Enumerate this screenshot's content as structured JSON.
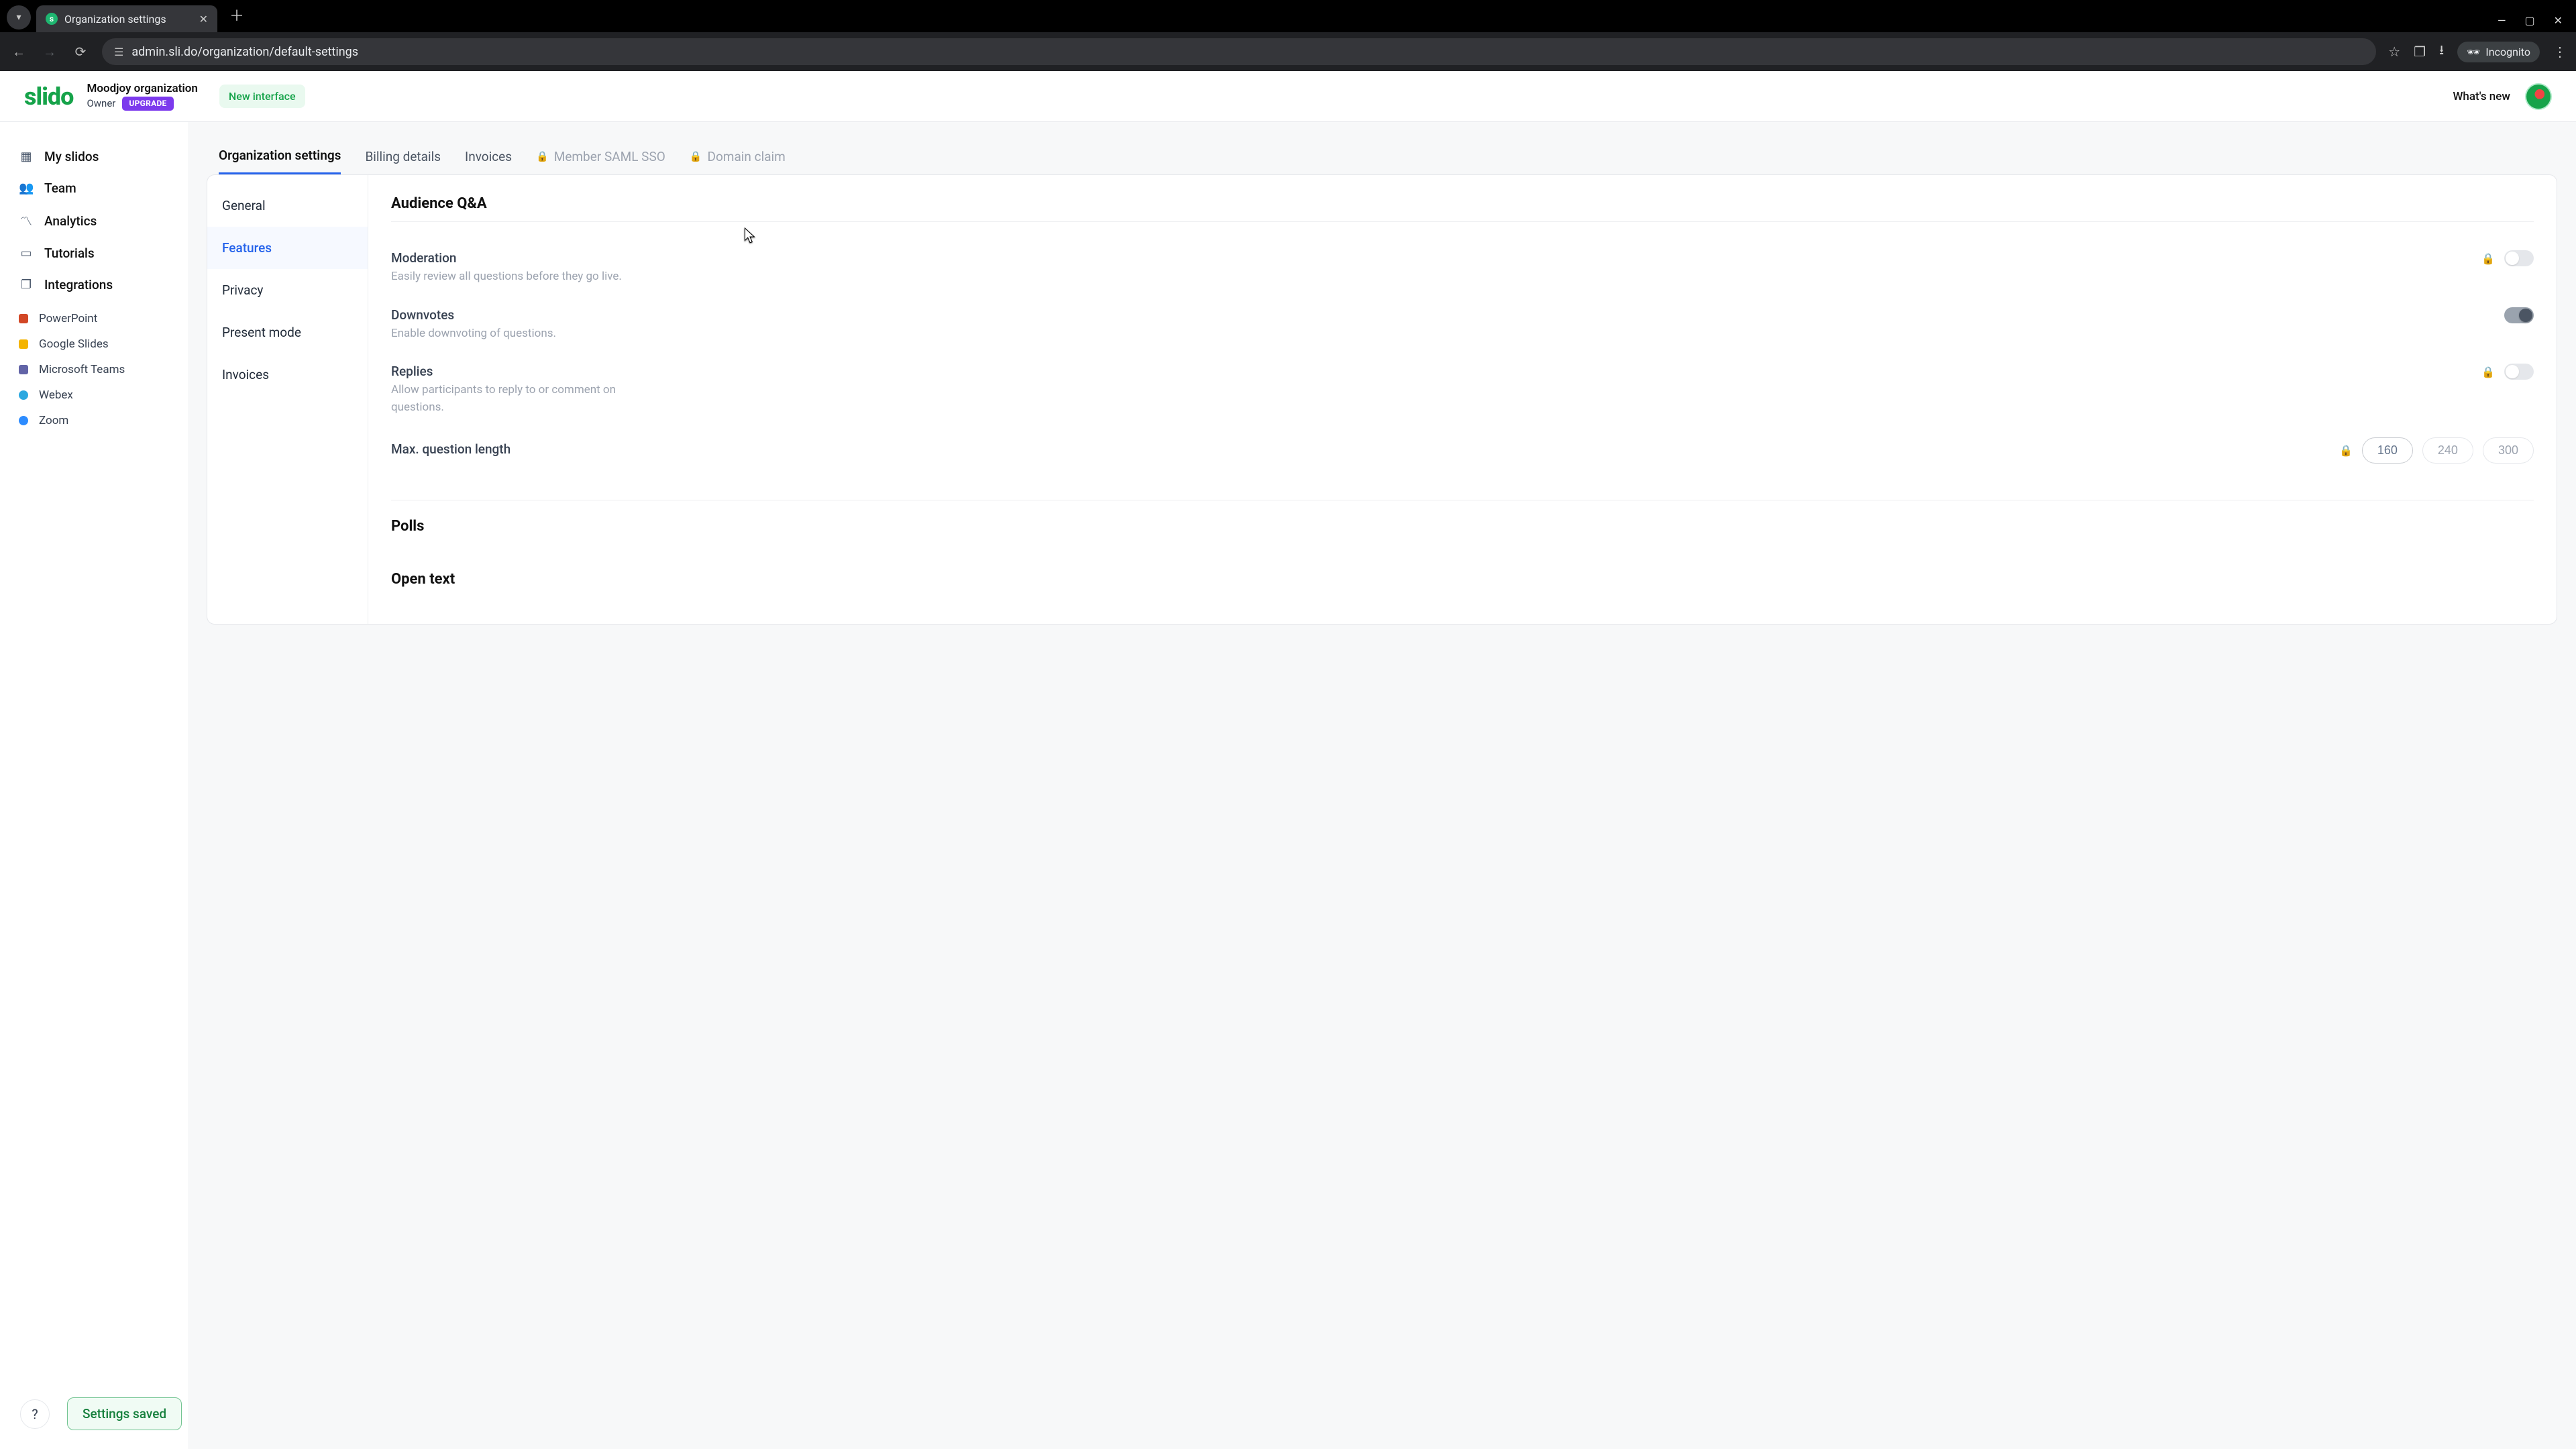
{
  "browser": {
    "tab_title": "Organization settings",
    "url": "admin.sli.do/organization/default-settings",
    "incognito_label": "Incognito"
  },
  "header": {
    "logo": "slido",
    "org_name": "Moodjoy organization",
    "role": "Owner",
    "upgrade": "UPGRADE",
    "new_interface": "New interface",
    "whats_new": "What's new"
  },
  "sidebar": {
    "primary": [
      {
        "label": "My slidos",
        "icon": "grid"
      },
      {
        "label": "Team",
        "icon": "users"
      },
      {
        "label": "Analytics",
        "icon": "chart"
      },
      {
        "label": "Tutorials",
        "icon": "book"
      },
      {
        "label": "Integrations",
        "icon": "puzzle"
      }
    ],
    "integrations": [
      {
        "label": "PowerPoint",
        "color": "#d24726"
      },
      {
        "label": "Google Slides",
        "color": "#f4b400"
      },
      {
        "label": "Microsoft Teams",
        "color": "#6264a7"
      },
      {
        "label": "Webex",
        "color": "#2ba8e0"
      },
      {
        "label": "Zoom",
        "color": "#2d8cff"
      }
    ]
  },
  "tabs": [
    {
      "label": "Organization settings",
      "active": true
    },
    {
      "label": "Billing details"
    },
    {
      "label": "Invoices"
    },
    {
      "label": "Member SAML SSO",
      "locked": true
    },
    {
      "label": "Domain claim",
      "locked": true
    }
  ],
  "subnav": [
    {
      "label": "General"
    },
    {
      "label": "Features",
      "active": true
    },
    {
      "label": "Privacy"
    },
    {
      "label": "Present mode"
    },
    {
      "label": "Invoices"
    }
  ],
  "sections": {
    "qa_title": "Audience Q&A",
    "polls_title": "Polls",
    "open_text_title": "Open text",
    "moderation_label": "Moderation",
    "moderation_desc": "Easily review all questions before they go live.",
    "downvotes_label": "Downvotes",
    "downvotes_desc": "Enable downvoting of questions.",
    "replies_label": "Replies",
    "replies_desc": "Allow participants to reply to or comment on questions.",
    "maxlen_label": "Max. question length",
    "maxlen_options": [
      "160",
      "240",
      "300"
    ],
    "maxlen_selected": "160"
  },
  "toast": "Settings saved",
  "help": "?"
}
